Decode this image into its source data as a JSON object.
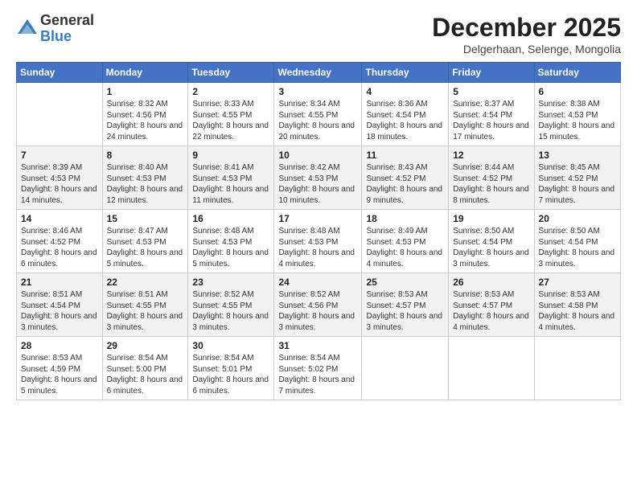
{
  "logo": {
    "general": "General",
    "blue": "Blue"
  },
  "title": "December 2025",
  "subtitle": "Delgerhaan, Selenge, Mongolia",
  "days_of_week": [
    "Sunday",
    "Monday",
    "Tuesday",
    "Wednesday",
    "Thursday",
    "Friday",
    "Saturday"
  ],
  "weeks": [
    [
      {
        "day": "",
        "sunrise": "",
        "sunset": "",
        "daylight": ""
      },
      {
        "day": "1",
        "sunrise": "Sunrise: 8:32 AM",
        "sunset": "Sunset: 4:56 PM",
        "daylight": "Daylight: 8 hours and 24 minutes."
      },
      {
        "day": "2",
        "sunrise": "Sunrise: 8:33 AM",
        "sunset": "Sunset: 4:55 PM",
        "daylight": "Daylight: 8 hours and 22 minutes."
      },
      {
        "day": "3",
        "sunrise": "Sunrise: 8:34 AM",
        "sunset": "Sunset: 4:55 PM",
        "daylight": "Daylight: 8 hours and 20 minutes."
      },
      {
        "day": "4",
        "sunrise": "Sunrise: 8:36 AM",
        "sunset": "Sunset: 4:54 PM",
        "daylight": "Daylight: 8 hours and 18 minutes."
      },
      {
        "day": "5",
        "sunrise": "Sunrise: 8:37 AM",
        "sunset": "Sunset: 4:54 PM",
        "daylight": "Daylight: 8 hours and 17 minutes."
      },
      {
        "day": "6",
        "sunrise": "Sunrise: 8:38 AM",
        "sunset": "Sunset: 4:53 PM",
        "daylight": "Daylight: 8 hours and 15 minutes."
      }
    ],
    [
      {
        "day": "7",
        "sunrise": "Sunrise: 8:39 AM",
        "sunset": "Sunset: 4:53 PM",
        "daylight": "Daylight: 8 hours and 14 minutes."
      },
      {
        "day": "8",
        "sunrise": "Sunrise: 8:40 AM",
        "sunset": "Sunset: 4:53 PM",
        "daylight": "Daylight: 8 hours and 12 minutes."
      },
      {
        "day": "9",
        "sunrise": "Sunrise: 8:41 AM",
        "sunset": "Sunset: 4:53 PM",
        "daylight": "Daylight: 8 hours and 11 minutes."
      },
      {
        "day": "10",
        "sunrise": "Sunrise: 8:42 AM",
        "sunset": "Sunset: 4:53 PM",
        "daylight": "Daylight: 8 hours and 10 minutes."
      },
      {
        "day": "11",
        "sunrise": "Sunrise: 8:43 AM",
        "sunset": "Sunset: 4:52 PM",
        "daylight": "Daylight: 8 hours and 9 minutes."
      },
      {
        "day": "12",
        "sunrise": "Sunrise: 8:44 AM",
        "sunset": "Sunset: 4:52 PM",
        "daylight": "Daylight: 8 hours and 8 minutes."
      },
      {
        "day": "13",
        "sunrise": "Sunrise: 8:45 AM",
        "sunset": "Sunset: 4:52 PM",
        "daylight": "Daylight: 8 hours and 7 minutes."
      }
    ],
    [
      {
        "day": "14",
        "sunrise": "Sunrise: 8:46 AM",
        "sunset": "Sunset: 4:52 PM",
        "daylight": "Daylight: 8 hours and 6 minutes."
      },
      {
        "day": "15",
        "sunrise": "Sunrise: 8:47 AM",
        "sunset": "Sunset: 4:53 PM",
        "daylight": "Daylight: 8 hours and 5 minutes."
      },
      {
        "day": "16",
        "sunrise": "Sunrise: 8:48 AM",
        "sunset": "Sunset: 4:53 PM",
        "daylight": "Daylight: 8 hours and 5 minutes."
      },
      {
        "day": "17",
        "sunrise": "Sunrise: 8:48 AM",
        "sunset": "Sunset: 4:53 PM",
        "daylight": "Daylight: 8 hours and 4 minutes."
      },
      {
        "day": "18",
        "sunrise": "Sunrise: 8:49 AM",
        "sunset": "Sunset: 4:53 PM",
        "daylight": "Daylight: 8 hours and 4 minutes."
      },
      {
        "day": "19",
        "sunrise": "Sunrise: 8:50 AM",
        "sunset": "Sunset: 4:54 PM",
        "daylight": "Daylight: 8 hours and 3 minutes."
      },
      {
        "day": "20",
        "sunrise": "Sunrise: 8:50 AM",
        "sunset": "Sunset: 4:54 PM",
        "daylight": "Daylight: 8 hours and 3 minutes."
      }
    ],
    [
      {
        "day": "21",
        "sunrise": "Sunrise: 8:51 AM",
        "sunset": "Sunset: 4:54 PM",
        "daylight": "Daylight: 8 hours and 3 minutes."
      },
      {
        "day": "22",
        "sunrise": "Sunrise: 8:51 AM",
        "sunset": "Sunset: 4:55 PM",
        "daylight": "Daylight: 8 hours and 3 minutes."
      },
      {
        "day": "23",
        "sunrise": "Sunrise: 8:52 AM",
        "sunset": "Sunset: 4:55 PM",
        "daylight": "Daylight: 8 hours and 3 minutes."
      },
      {
        "day": "24",
        "sunrise": "Sunrise: 8:52 AM",
        "sunset": "Sunset: 4:56 PM",
        "daylight": "Daylight: 8 hours and 3 minutes."
      },
      {
        "day": "25",
        "sunrise": "Sunrise: 8:53 AM",
        "sunset": "Sunset: 4:57 PM",
        "daylight": "Daylight: 8 hours and 3 minutes."
      },
      {
        "day": "26",
        "sunrise": "Sunrise: 8:53 AM",
        "sunset": "Sunset: 4:57 PM",
        "daylight": "Daylight: 8 hours and 4 minutes."
      },
      {
        "day": "27",
        "sunrise": "Sunrise: 8:53 AM",
        "sunset": "Sunset: 4:58 PM",
        "daylight": "Daylight: 8 hours and 4 minutes."
      }
    ],
    [
      {
        "day": "28",
        "sunrise": "Sunrise: 8:53 AM",
        "sunset": "Sunset: 4:59 PM",
        "daylight": "Daylight: 8 hours and 5 minutes."
      },
      {
        "day": "29",
        "sunrise": "Sunrise: 8:54 AM",
        "sunset": "Sunset: 5:00 PM",
        "daylight": "Daylight: 8 hours and 6 minutes."
      },
      {
        "day": "30",
        "sunrise": "Sunrise: 8:54 AM",
        "sunset": "Sunset: 5:01 PM",
        "daylight": "Daylight: 8 hours and 6 minutes."
      },
      {
        "day": "31",
        "sunrise": "Sunrise: 8:54 AM",
        "sunset": "Sunset: 5:02 PM",
        "daylight": "Daylight: 8 hours and 7 minutes."
      },
      {
        "day": "",
        "sunrise": "",
        "sunset": "",
        "daylight": ""
      },
      {
        "day": "",
        "sunrise": "",
        "sunset": "",
        "daylight": ""
      },
      {
        "day": "",
        "sunrise": "",
        "sunset": "",
        "daylight": ""
      }
    ]
  ]
}
